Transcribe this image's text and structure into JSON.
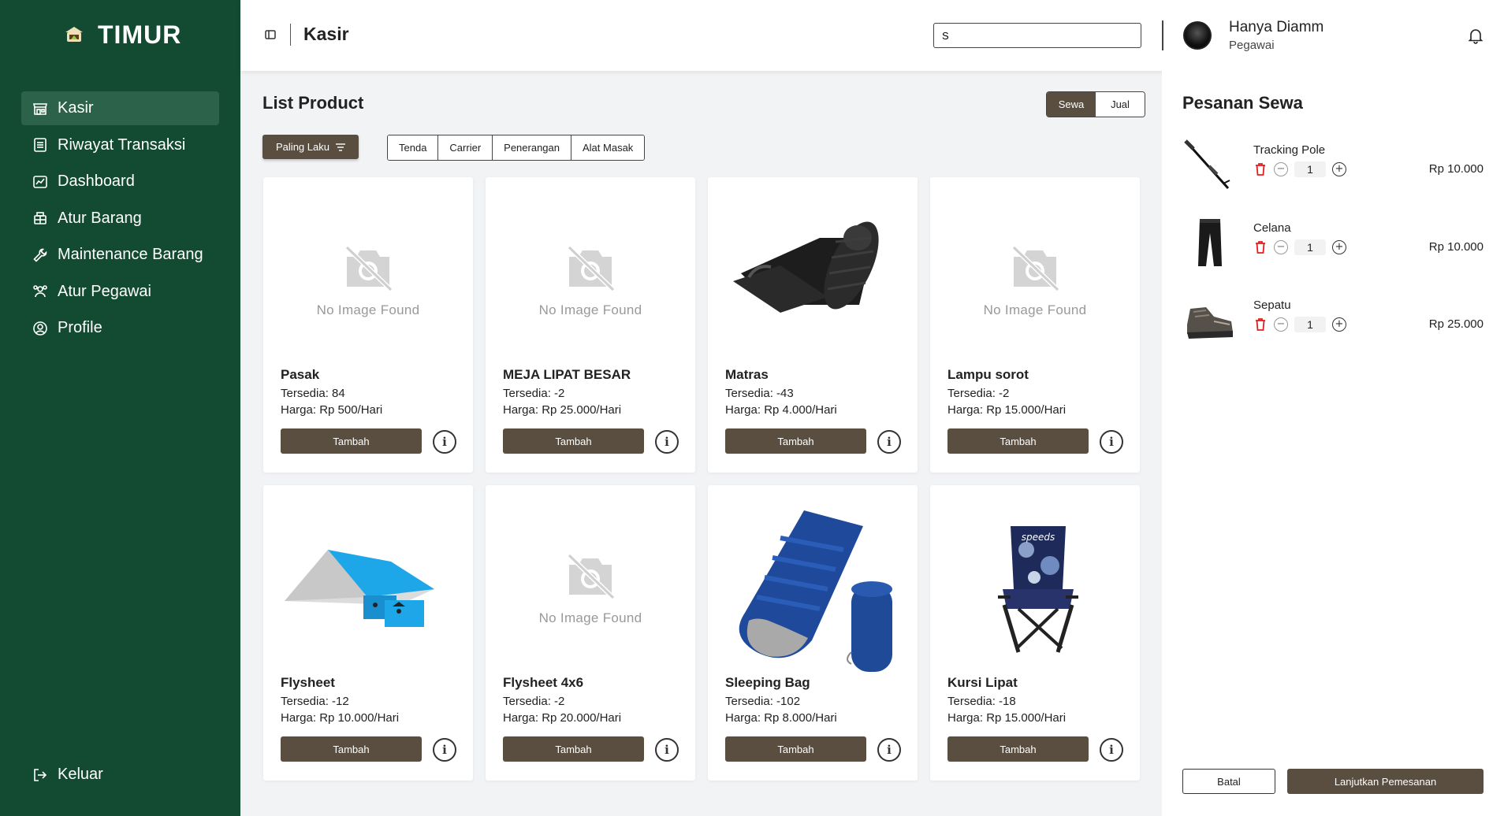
{
  "sidebar": {
    "brand": "TIMUR",
    "items": [
      {
        "label": "Kasir",
        "icon": "store-icon",
        "active": true
      },
      {
        "label": "Riwayat Transaksi",
        "icon": "receipt-icon"
      },
      {
        "label": "Dashboard",
        "icon": "chart-icon"
      },
      {
        "label": "Atur Barang",
        "icon": "box-icon"
      },
      {
        "label": "Maintenance Barang",
        "icon": "wrench-icon"
      },
      {
        "label": "Atur Pegawai",
        "icon": "users-icon"
      },
      {
        "label": "Profile",
        "icon": "user-circle-icon"
      }
    ],
    "logout": "Keluar"
  },
  "header": {
    "title": "Kasir",
    "search_value": "S",
    "user_name": "Hanya Diamm",
    "user_role": "Pegawai"
  },
  "main": {
    "title": "List Product",
    "modes": [
      "Sewa",
      "Jual"
    ],
    "active_mode": "Sewa",
    "sort_label": "Paling Laku",
    "categories": [
      "Tenda",
      "Carrier",
      "Penerangan",
      "Alat Masak"
    ],
    "no_image_text": "No Image Found",
    "add_label": "Tambah",
    "products": [
      {
        "name": "Pasak",
        "stock": "Tersedia: 84",
        "price": "Harga: Rp 500/Hari",
        "image": "none"
      },
      {
        "name": "MEJA LIPAT BESAR",
        "stock": "Tersedia: -2",
        "price": "Harga: Rp 25.000/Hari",
        "image": "none"
      },
      {
        "name": "Matras",
        "stock": "Tersedia: -43",
        "price": "Harga: Rp 4.000/Hari",
        "image": "mat"
      },
      {
        "name": "Lampu sorot",
        "stock": "Tersedia: -2",
        "price": "Harga: Rp 15.000/Hari",
        "image": "none"
      },
      {
        "name": "Flysheet",
        "stock": "Tersedia: -12",
        "price": "Harga: Rp 10.000/Hari",
        "image": "flysheet"
      },
      {
        "name": "Flysheet 4x6",
        "stock": "Tersedia: -2",
        "price": "Harga: Rp 20.000/Hari",
        "image": "none"
      },
      {
        "name": "Sleeping Bag",
        "stock": "Tersedia: -102",
        "price": "Harga: Rp 8.000/Hari",
        "image": "sleepingbag"
      },
      {
        "name": "Kursi Lipat",
        "stock": "Tersedia: -18",
        "price": "Harga: Rp 15.000/Hari",
        "image": "chair"
      }
    ]
  },
  "order_panel": {
    "title": "Pesanan Sewa",
    "items": [
      {
        "name": "Tracking Pole",
        "qty": "1",
        "price": "Rp 10.000",
        "image": "pole"
      },
      {
        "name": "Celana",
        "qty": "1",
        "price": "Rp 10.000",
        "image": "pants"
      },
      {
        "name": "Sepatu",
        "qty": "1",
        "price": "Rp 25.000",
        "image": "shoe"
      }
    ],
    "cancel_label": "Batal",
    "continue_label": "Lanjutkan Pemesanan"
  },
  "colors": {
    "sidebar_bg": "#134a32",
    "sidebar_active": "#2b6249",
    "button_brown": "#5a4e40",
    "trash_red": "#e02020",
    "page_bg": "#f2f3f5"
  }
}
